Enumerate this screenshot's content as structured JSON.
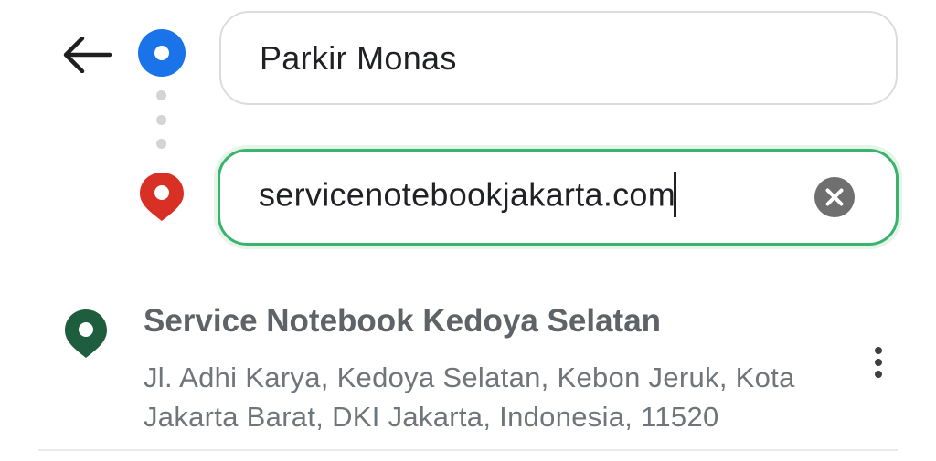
{
  "icons": {
    "back": "arrow-left-icon",
    "origin": "origin-circle-icon",
    "destination": "destination-pin-icon",
    "clear": "clear-circle-icon",
    "result": "place-pin-icon",
    "more": "more-vertical-icon"
  },
  "colors": {
    "origin_blue": "#1a73e8",
    "destination_red": "#ea4335",
    "result_pin_green": "#1e5e3f",
    "focus_green": "#3ab46c",
    "clear_grey": "#6f6f6f"
  },
  "directions": {
    "origin_value": "Parkir Monas",
    "destination_value": "servicenotebookjakarta.com"
  },
  "results": [
    {
      "title": "Service Notebook Kedoya Selatan",
      "address": "Jl. Adhi Karya, Kedoya Selatan, Kebon Jeruk, Kota Jakarta Barat, DKI Jakarta, Indonesia, 11520"
    }
  ]
}
